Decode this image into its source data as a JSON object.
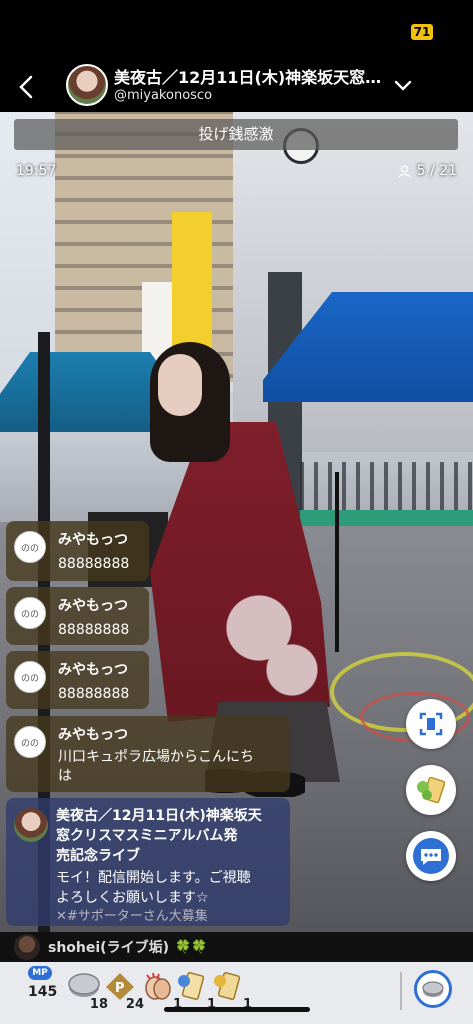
{
  "status_bar": {
    "battery": "71"
  },
  "header": {
    "title": "美夜古／12月11日(木)神楽坂天窓…",
    "handle": "@miyakonosco"
  },
  "notice": "投げ銭感激",
  "time": "19:57",
  "viewers": "5 / 21",
  "comments": [
    {
      "name": "みやもっつ",
      "text": "88888888"
    },
    {
      "name": "みやもっつ",
      "text": "88888888"
    },
    {
      "name": "みやもっつ",
      "text": "88888888"
    },
    {
      "name": "みやもっつ",
      "text_line1": "川口キュポラ広場からこんにち",
      "text_line2": "は"
    }
  ],
  "host_comment": {
    "title_line1": "美夜古／12月11日(木)神楽坂天",
    "title_line2": "窓クリスマスミニアルバム発",
    "title_line3": "売記念ライブ",
    "body_line1": "モイ！配信開始します。ご視聴",
    "body_line2": "よろしくお願いします☆",
    "tag": "✕#サポーターさん大募集"
  },
  "next_viewer": {
    "name": "shohei(ライブ垢)",
    "badge": "🍀🍀"
  },
  "gift_bar": {
    "mp_label": "MP",
    "mp_count": "145",
    "gifts": [
      {
        "icon": "coin-icon",
        "count": "18"
      },
      {
        "icon": "p-ticket-icon",
        "count": "24"
      },
      {
        "icon": "clap-icon",
        "count": "1"
      },
      {
        "icon": "card-icon",
        "count": "1"
      },
      {
        "icon": "card-gold-icon",
        "count": "1"
      }
    ]
  },
  "colors": {
    "accent": "#2d6fd3",
    "battery": "#f2c10f",
    "comment_bg": "#463a1e",
    "host_comment_bg": "#303c6e"
  }
}
